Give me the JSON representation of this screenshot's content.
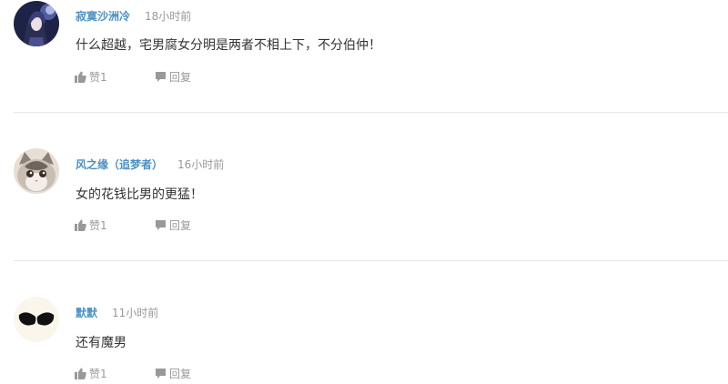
{
  "comments": [
    {
      "username": "寂寞沙洲冷",
      "time": "18小时前",
      "content": "什么超越，宅男腐女分明是两者不相上下，不分伯仲！",
      "like_label": "赞1",
      "reply_label": "回复"
    },
    {
      "username": "风之缘（追梦者）",
      "time": "16小时前",
      "content": "女的花钱比男的更猛！",
      "like_label": "赞1",
      "reply_label": "回复"
    },
    {
      "username": "默默",
      "time": "11小时前",
      "content": "还有魔男",
      "like_label": "赞1",
      "reply_label": "回复"
    }
  ],
  "icons": {
    "like": "thumbs-up-icon",
    "reply": "speech-bubble-icon"
  },
  "colors": {
    "username": "#4a90c6",
    "meta": "#999999",
    "text": "#333333",
    "divider": "#e8e8e8"
  }
}
